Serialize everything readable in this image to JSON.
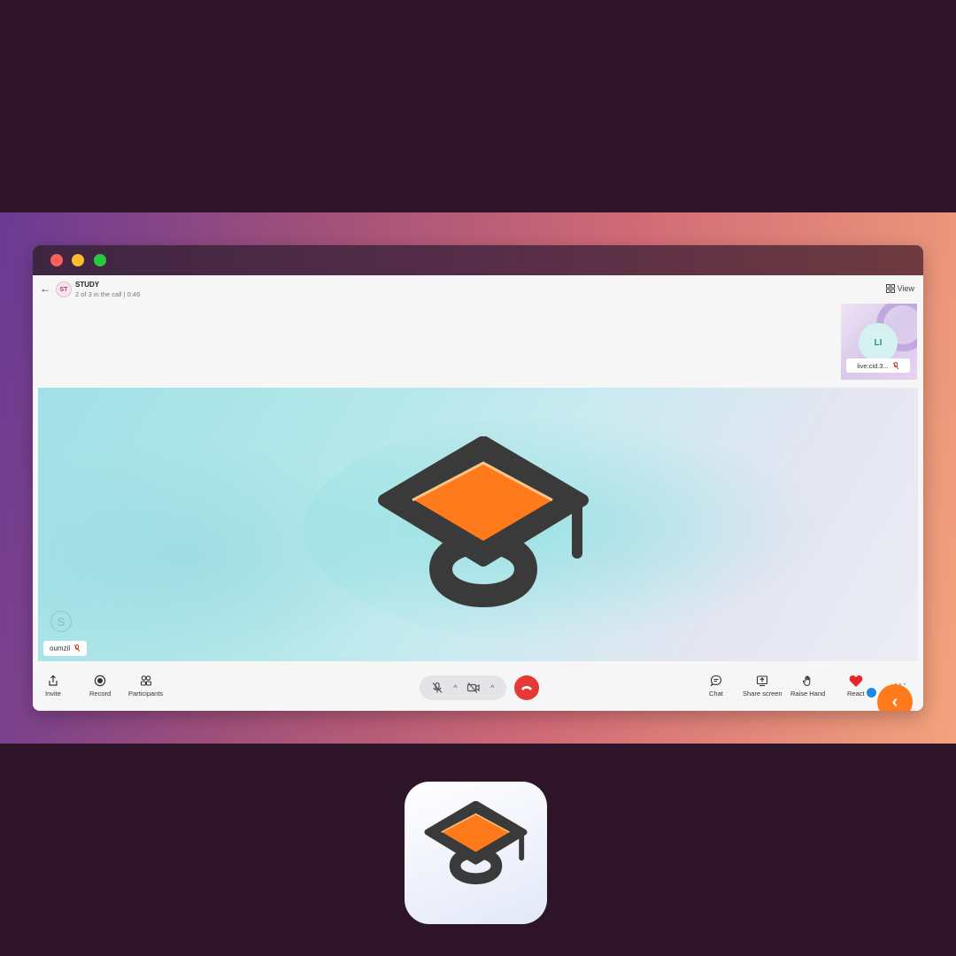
{
  "call": {
    "back_icon": "arrow-left-icon",
    "room_initials": "ST",
    "room_name": "STUDY",
    "status": "2 of 3 in the call | 0:46",
    "view_label": "View"
  },
  "participants": {
    "thumbnail": {
      "initials": "LI",
      "name": "live:cid.3..."
    },
    "main": {
      "name": "oumzil"
    }
  },
  "toolbar": {
    "left": [
      {
        "label": "Invite",
        "icon": "share-icon"
      },
      {
        "label": "Record",
        "icon": "record-icon"
      },
      {
        "label": "Participants",
        "icon": "participants-icon"
      }
    ],
    "right": [
      {
        "label": "Chat",
        "icon": "chat-icon"
      },
      {
        "label": "Share screen",
        "icon": "share-screen-icon"
      },
      {
        "label": "Raise Hand",
        "icon": "raise-hand-icon"
      },
      {
        "label": "React",
        "icon": "heart-icon"
      }
    ],
    "more_label": "···"
  },
  "colors": {
    "background": "#2e1429",
    "accent_orange": "#ff7a1a",
    "hangup_red": "#e53935",
    "logo_dark": "#3a3a3a"
  }
}
